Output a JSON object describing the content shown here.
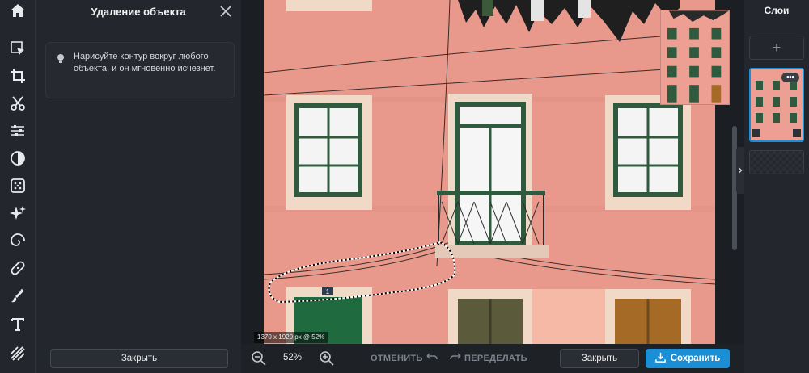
{
  "panel": {
    "title": "Удаление объекта",
    "hint": "Нарисуйте контур вокруг любого объекта, и он мгновенно исчезнет.",
    "close_button": "Закрыть"
  },
  "toolstrip": {
    "icons": [
      "home-icon",
      "select-icon",
      "crop-icon",
      "cut-icon",
      "adjust-icon",
      "contrast-icon",
      "texture-icon",
      "magic-icon",
      "spiral-icon",
      "healing-icon",
      "brush-icon",
      "text-icon",
      "pattern-icon"
    ]
  },
  "canvas": {
    "size_label": "1370 x 1920 px @ 52%",
    "building_number": "1"
  },
  "layers": {
    "title": "Слои",
    "add": "+",
    "menu": "•••"
  },
  "bottombar": {
    "zoom": "52%",
    "undo": "ОТМЕНИТЬ",
    "redo": "ПЕРЕДЕЛАТЬ",
    "close": "Закрыть",
    "save": "Сохранить"
  },
  "colors": {
    "accent": "#1b8fd6",
    "facade": "#e89a8c",
    "window_frame": "#2f5a3e"
  }
}
